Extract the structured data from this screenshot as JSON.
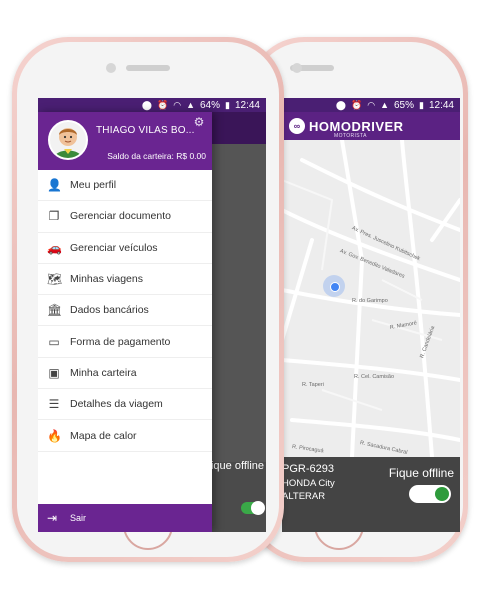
{
  "status_bar_left": {
    "battery": "64%",
    "time": "12:44"
  },
  "status_bar_right": {
    "battery": "65%",
    "time": "12:44"
  },
  "drawer": {
    "user_name": "THIAGO VILAS BO...",
    "wallet_balance": "Saldo da carteira: R$ 0.00",
    "items": [
      {
        "label": "Meu perfil",
        "icon": "person-icon"
      },
      {
        "label": "Gerenciar documento",
        "icon": "document-icon"
      },
      {
        "label": "Gerenciar veículos",
        "icon": "car-icon"
      },
      {
        "label": "Minhas viagens",
        "icon": "map-icon"
      },
      {
        "label": "Dados bancários",
        "icon": "bank-icon"
      },
      {
        "label": "Forma de pagamento",
        "icon": "card-icon"
      },
      {
        "label": "Minha carteira",
        "icon": "wallet-icon"
      },
      {
        "label": "Detalhes da viagem",
        "icon": "list-icon"
      },
      {
        "label": "Mapa de calor",
        "icon": "flame-icon"
      }
    ],
    "logout_label": "Sair"
  },
  "left_offline": "Fique offline",
  "brand": {
    "name": "HOMODRIVER",
    "subtitle": "MOTORISTA"
  },
  "map_streets": [
    "Av. Pres. Juscelino Kubitschek",
    "Av. Gov. Benedito Valadares",
    "R. do Garimpo",
    "R. Mamoré",
    "R. Candelária",
    "R. Cel. Camisão",
    "R. Taperi",
    "R. Sacadura Cabral",
    "R. Pirocaguá"
  ],
  "vehicle": {
    "plate": "PGR-6293",
    "model": "HONDA City",
    "change_label": "ALTERAR"
  },
  "offline_toggle_label": "Fique offline",
  "colors": {
    "brand_purple": "#6a2591",
    "toggle_green": "#2e9b3c"
  }
}
